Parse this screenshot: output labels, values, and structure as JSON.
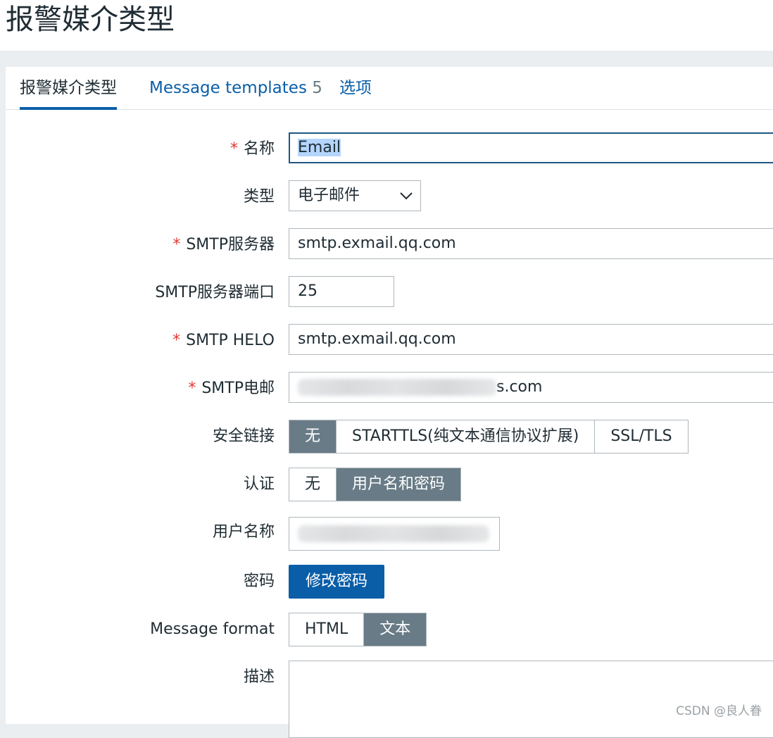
{
  "page": {
    "title": "报警媒介类型"
  },
  "tabs": [
    {
      "label": "报警媒介类型"
    },
    {
      "label": "Message templates",
      "count": "5"
    },
    {
      "label": "选项"
    }
  ],
  "form": {
    "name": {
      "label": "名称",
      "value": "Email"
    },
    "type": {
      "label": "类型",
      "value": "电子邮件"
    },
    "smtp_server": {
      "label": "SMTP服务器",
      "value": "smtp.exmail.qq.com"
    },
    "smtp_port": {
      "label": "SMTP服务器端口",
      "value": "25"
    },
    "smtp_helo": {
      "label": "SMTP HELO",
      "value": "smtp.exmail.qq.com"
    },
    "smtp_email": {
      "label": "SMTP电邮",
      "value_suffix": "s.com"
    },
    "security": {
      "label": "安全链接",
      "options": [
        "无",
        "STARTTLS(纯文本通信协议扩展)",
        "SSL/TLS"
      ],
      "selected": "无"
    },
    "auth": {
      "label": "认证",
      "options": [
        "无",
        "用户名和密码"
      ],
      "selected": "用户名和密码"
    },
    "username": {
      "label": "用户名称"
    },
    "password": {
      "label": "密码",
      "button": "修改密码"
    },
    "message_format": {
      "label": "Message format",
      "options": [
        "HTML",
        "文本"
      ],
      "selected": "文本"
    },
    "description": {
      "label": "描述"
    }
  },
  "watermark": "CSDN @良人眷",
  "colors": {
    "link": "#0a5ea8",
    "required": "#e33734",
    "segment_active": "#687b86"
  }
}
